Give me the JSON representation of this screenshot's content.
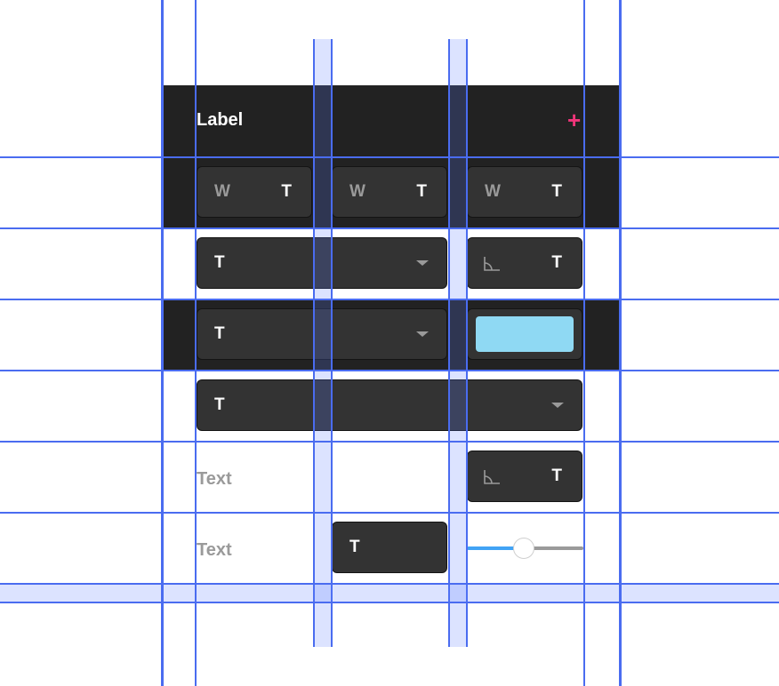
{
  "header": {
    "label": "Label",
    "add_symbol": "+"
  },
  "row_wt": [
    {
      "left": "W",
      "right": "T"
    },
    {
      "left": "W",
      "right": "T"
    },
    {
      "left": "W",
      "right": "T"
    }
  ],
  "row2": {
    "select_value": "T",
    "angle_value": "T"
  },
  "row3": {
    "select_value": "T",
    "color_swatch": "#8fd9f3"
  },
  "row4": {
    "select_value": "T"
  },
  "row5": {
    "label": "Text",
    "angle_value": "T"
  },
  "row6": {
    "label": "Text",
    "input_value": "T",
    "slider_fraction": 0.5
  },
  "colors": {
    "panel": "#222222",
    "field": "#333333",
    "accent": "#f0357a",
    "slider_active": "#41a3f5",
    "guide": "#4a6cf0"
  }
}
